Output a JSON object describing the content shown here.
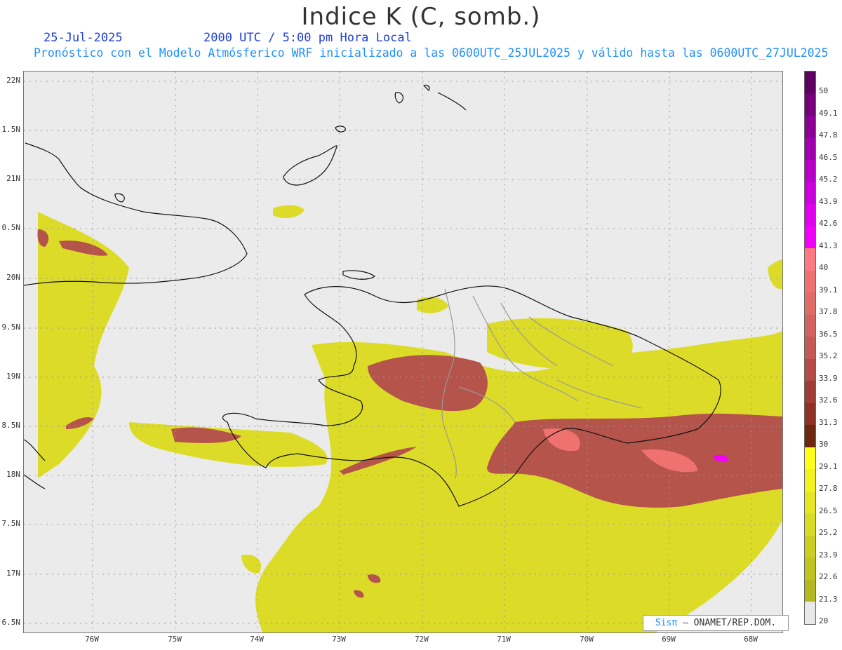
{
  "header": {
    "title": "Indice K (C, somb.)",
    "date": "25-Jul-2025",
    "time": "2000 UTC / 5:00 pm Hora Local",
    "subtitle": "Pronóstico con el Modelo Atmósferico WRF inicializado a las 0600UTC_25JUL2025 y válido hasta las  0600UTC_27JUL2025"
  },
  "axes": {
    "lat_labels": [
      "22N",
      "1.5N",
      "21N",
      "0.5N",
      "20N",
      "9.5N",
      "19N",
      "8.5N",
      "18N",
      "7.5N",
      "17N",
      "6.5N"
    ],
    "lon_labels": [
      "76W",
      "75W",
      "74W",
      "73W",
      "72W",
      "71W",
      "70W",
      "69W",
      "68W"
    ]
  },
  "colorbar": {
    "labels": [
      "50",
      "49.1",
      "47.8",
      "46.5",
      "45.2",
      "43.9",
      "42.6",
      "41.3",
      "40",
      "39.1",
      "37.8",
      "36.5",
      "35.2",
      "33.9",
      "32.6",
      "31.3",
      "30",
      "29.1",
      "27.8",
      "26.5",
      "25.2",
      "23.9",
      "22.6",
      "21.3",
      "20"
    ],
    "colors": [
      "#5e0060",
      "#74007a",
      "#8a0094",
      "#a000ae",
      "#b800c8",
      "#cc00dc",
      "#e000ee",
      "#f200fa",
      "#ff7a80",
      "#f07270",
      "#e06c68",
      "#d26460",
      "#c45a54",
      "#b24c44",
      "#a03e36",
      "#8e3226",
      "#6e2810",
      "#ffff1a",
      "#f2f21e",
      "#e6e622",
      "#d8dc24",
      "#cccf22",
      "#c0c420",
      "#b4b81e",
      "#e8e8e8"
    ]
  },
  "credit": {
    "sis": "Sisπ",
    "org": " – ONAMET/REP.DOM."
  }
}
